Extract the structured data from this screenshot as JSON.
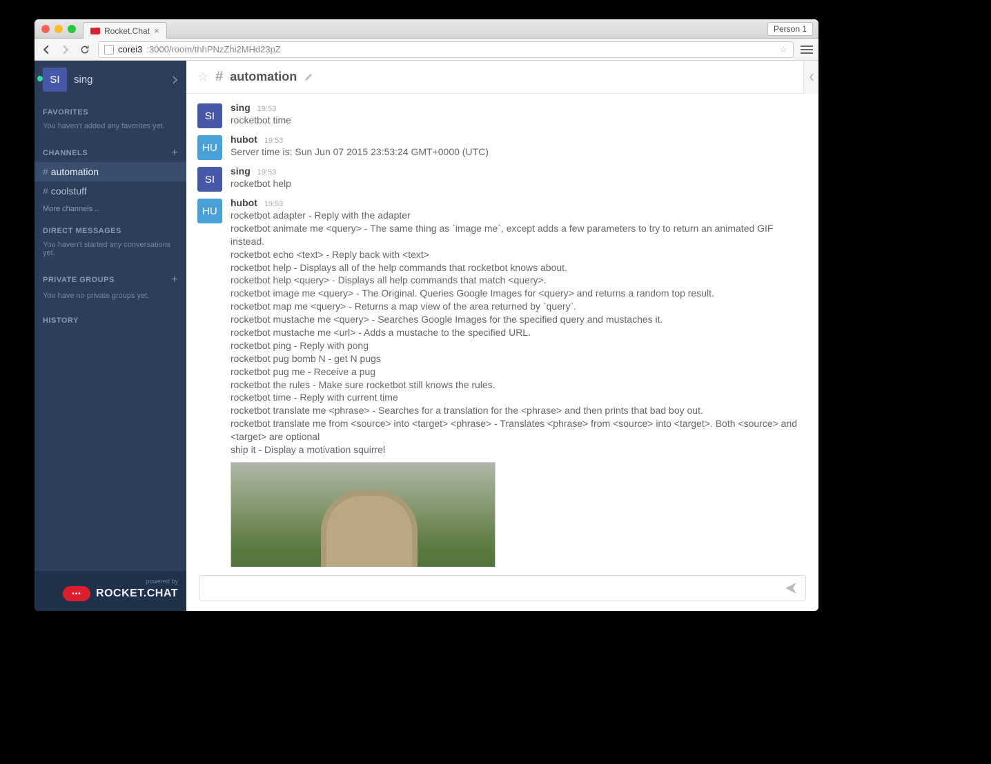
{
  "browser": {
    "tab_title": "Rocket.Chat",
    "person_label": "Person 1",
    "url_domain": "corei3",
    "url_path": ":3000/room/thhPNzZhi2MHd23pZ"
  },
  "sidebar": {
    "user": {
      "initials": "SI",
      "name": "sing"
    },
    "favorites": {
      "label": "FAVORITES",
      "hint": "You haven't added any favorites yet."
    },
    "channels": {
      "label": "CHANNELS",
      "items": [
        {
          "hash": "#",
          "name": "automation",
          "active": true
        },
        {
          "hash": "#",
          "name": "coolstuff",
          "active": false
        }
      ],
      "more": "More channels .."
    },
    "dm": {
      "label": "DIRECT MESSAGES",
      "hint": "You haven't started any conversations yet."
    },
    "groups": {
      "label": "PRIVATE GROUPS",
      "hint": "You have no private groups yet."
    },
    "history": {
      "label": "HISTORY"
    },
    "footer": {
      "powered": "powered by",
      "brand": "ROCKET.CHAT",
      "dots": "•••"
    }
  },
  "header": {
    "hash": "#",
    "channel": "automation"
  },
  "messages": [
    {
      "user": "sing",
      "avatar": "SI",
      "avclass": "av-si",
      "time": "19:53",
      "lines": [
        "rocketbot time"
      ]
    },
    {
      "user": "hubot",
      "avatar": "HU",
      "avclass": "av-hu",
      "time": "19:53",
      "lines": [
        "Server time is: Sun Jun 07 2015 23:53:24 GMT+0000 (UTC)"
      ]
    },
    {
      "user": "sing",
      "avatar": "SI",
      "avclass": "av-si",
      "time": "19:53",
      "lines": [
        "rocketbot help"
      ]
    },
    {
      "user": "hubot",
      "avatar": "HU",
      "avclass": "av-hu",
      "time": "19:53",
      "lines": [
        "rocketbot adapter - Reply with the adapter",
        "rocketbot animate me <query> - The same thing as `image me`, except adds a few parameters to try to return an animated GIF instead.",
        "rocketbot echo <text> - Reply back with <text>",
        "rocketbot help - Displays all of the help commands that rocketbot knows about.",
        "rocketbot help <query> - Displays all help commands that match <query>.",
        "rocketbot image me <query> - The Original. Queries Google Images for <query> and returns a random top result.",
        "rocketbot map me <query> - Returns a map view of the area returned by `query`.",
        "rocketbot mustache me <query> - Searches Google Images for the specified query and mustaches it.",
        "rocketbot mustache me <url> - Adds a mustache to the specified URL.",
        "rocketbot ping - Reply with pong",
        "rocketbot pug bomb N - get N pugs",
        "rocketbot pug me - Receive a pug",
        "rocketbot the rules - Make sure rocketbot still knows the rules.",
        "rocketbot time - Reply with current time",
        "rocketbot translate me <phrase> - Searches for a translation for the <phrase> and then prints that bad boy out.",
        "rocketbot translate me from <source> into <target> <phrase> - Translates <phrase> from <source> into <target>. Both <source> and <target> are optional",
        "ship it - Display a motivation squirrel"
      ],
      "has_image": true
    }
  ],
  "compose": {
    "placeholder": ""
  }
}
